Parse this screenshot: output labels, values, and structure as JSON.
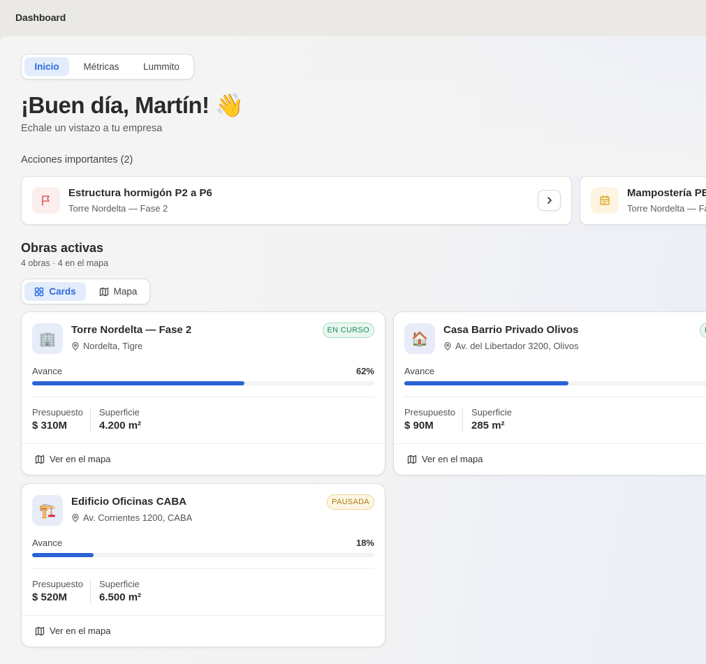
{
  "header": {
    "title": "Dashboard"
  },
  "tabs": [
    {
      "label": "Inicio",
      "active": true
    },
    {
      "label": "Métricas",
      "active": false
    },
    {
      "label": "Lummito",
      "active": false
    }
  ],
  "greeting": {
    "text": "¡Buen día, Martín! 👋",
    "subtitle": "Echale un vistazo a tu empresa"
  },
  "actions": {
    "label": "Acciones importantes (2)",
    "items": [
      {
        "title": "Estructura hormigón P2 a P6",
        "subtitle": "Torre Nordelta — Fase 2",
        "icon": "flag-icon",
        "color": "#e05a5a"
      },
      {
        "title": "Mampostería PB",
        "subtitle": "Torre Nordelta — Fa",
        "icon": "calendar-icon",
        "color": "#e0a92a"
      }
    ]
  },
  "obras": {
    "title": "Obras activas",
    "count": "4 obras · 4 en el mapa",
    "view_toggle": [
      {
        "label": "Cards",
        "icon": "grid-icon",
        "active": true
      },
      {
        "label": "Mapa",
        "icon": "map-icon",
        "active": false
      }
    ],
    "labels": {
      "avance": "Avance",
      "presupuesto": "Presupuesto",
      "superficie": "Superficie",
      "map_link": "Ver en el mapa"
    },
    "cards": [
      {
        "emoji": "🏢",
        "name": "Torre Nordelta — Fase 2",
        "location": "Nordelta, Tigre",
        "status": "EN CURSO",
        "status_color": "#1c8a5a",
        "progress_pct": "62%",
        "progress": 0.62,
        "budget": "$ 310M",
        "area": "4.200 m²"
      },
      {
        "emoji": "🏠",
        "name": "Casa Barrio Privado Olivos",
        "location": "Av. del Libertador 3200, Olivos",
        "status": "EN CURSO",
        "status_color": "#1c8a5a",
        "progress_pct": "",
        "progress": 0.48,
        "budget": "$ 90M",
        "area": "285 m²"
      },
      {
        "emoji": "🏗️",
        "name": "Edificio Oficinas CABA",
        "location": "Av. Corrientes 1200, CABA",
        "status": "PAUSADA",
        "status_color": "#b07a12",
        "progress_pct": "18%",
        "progress": 0.18,
        "budget": "$ 520M",
        "area": "6.500 m²"
      }
    ]
  },
  "colors": {
    "accent": "#2d6be0",
    "progress": "#2a63d4"
  }
}
